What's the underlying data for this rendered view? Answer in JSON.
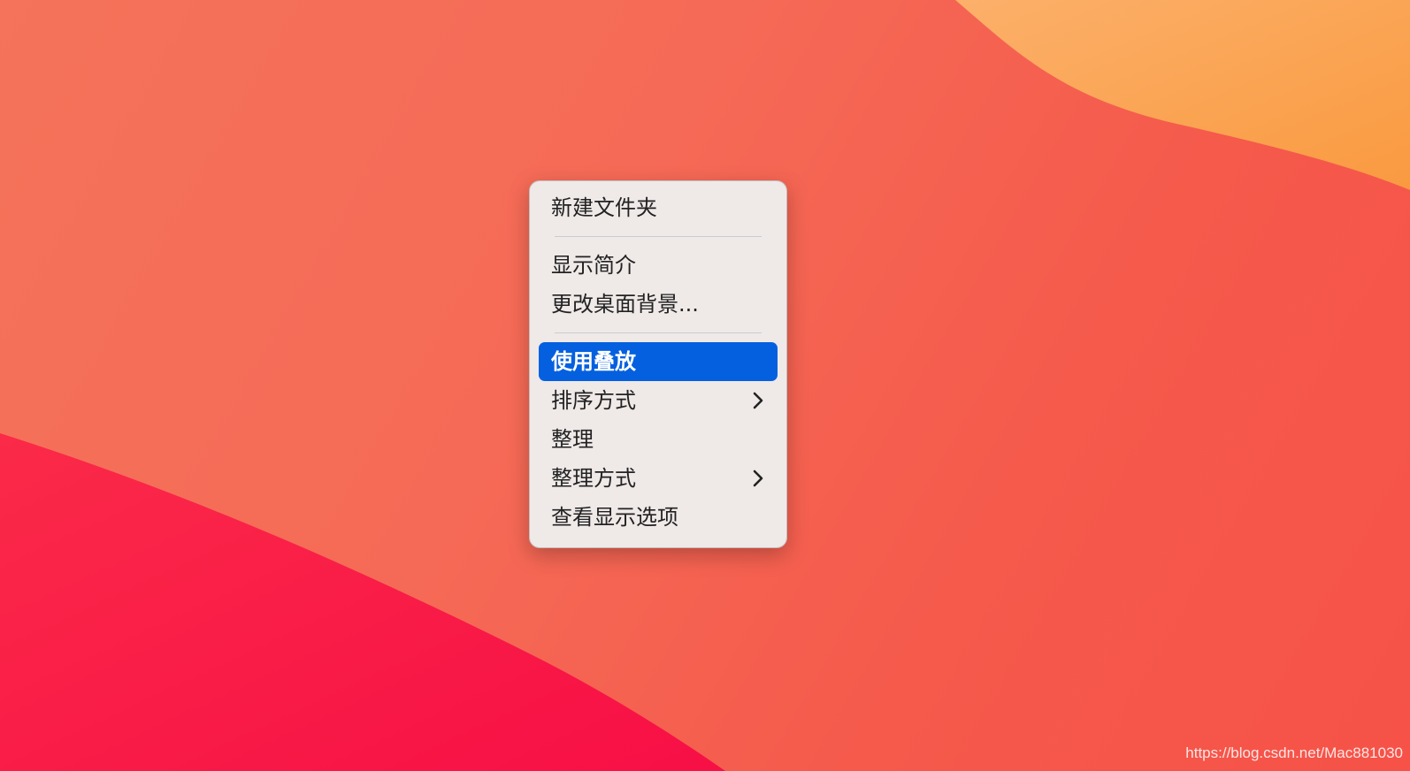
{
  "colors": {
    "highlight": "#0560e0",
    "menu_background": "#eeeeee",
    "wallpaper_base": "#f56a56",
    "wallpaper_orange": "#f9a24c",
    "wallpaper_magenta": "#f91a45"
  },
  "context_menu": {
    "items": [
      {
        "label": "新建文件夹",
        "has_submenu": false,
        "highlighted": false
      },
      {
        "label": "显示简介",
        "has_submenu": false,
        "highlighted": false
      },
      {
        "label": "更改桌面背景...",
        "has_submenu": false,
        "highlighted": false
      },
      {
        "label": "使用叠放",
        "has_submenu": false,
        "highlighted": true
      },
      {
        "label": "排序方式",
        "has_submenu": true,
        "highlighted": false,
        "submenu_icon": "chevron-right-icon"
      },
      {
        "label": "整理",
        "has_submenu": false,
        "highlighted": false
      },
      {
        "label": "整理方式",
        "has_submenu": true,
        "highlighted": false,
        "submenu_icon": "chevron-right-icon"
      },
      {
        "label": "查看显示选项",
        "has_submenu": false,
        "highlighted": false
      }
    ]
  },
  "watermark": {
    "text": "https://blog.csdn.net/Mac881030"
  }
}
